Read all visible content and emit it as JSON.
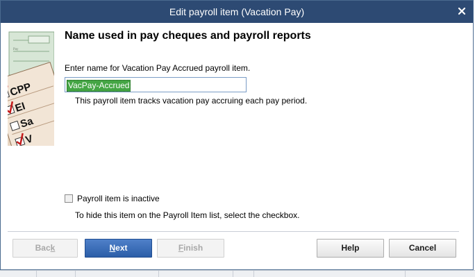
{
  "window": {
    "title": "Edit payroll item (Vacation Pay)",
    "close_icon": "close-icon"
  },
  "illustration": {
    "icon": "payroll-checklist-illustration",
    "labels": [
      "CPP",
      "EI",
      "Sa",
      "V"
    ]
  },
  "main": {
    "heading": "Name used in pay cheques and payroll reports",
    "prompt": "Enter name for Vacation Pay Accrued payroll item.",
    "name_value": "VacPay-Accrued",
    "help": "This payroll item tracks vacation pay accruing each pay period.",
    "inactive_label": "Payroll item is inactive",
    "inactive_checked": false,
    "inactive_help": "To hide this item on the Payroll Item list, select the checkbox."
  },
  "buttons": {
    "back": {
      "first": "Bac",
      "accel": "k",
      "rest": ""
    },
    "next": {
      "first": "",
      "accel": "N",
      "rest": "ext"
    },
    "finish": {
      "first": "",
      "accel": "F",
      "rest": "inish"
    },
    "help": "Help",
    "cancel": "Cancel"
  },
  "colors": {
    "titlebar": "#2d4a73",
    "primary_button": "#2b5ea8",
    "selection": "#44a544"
  }
}
